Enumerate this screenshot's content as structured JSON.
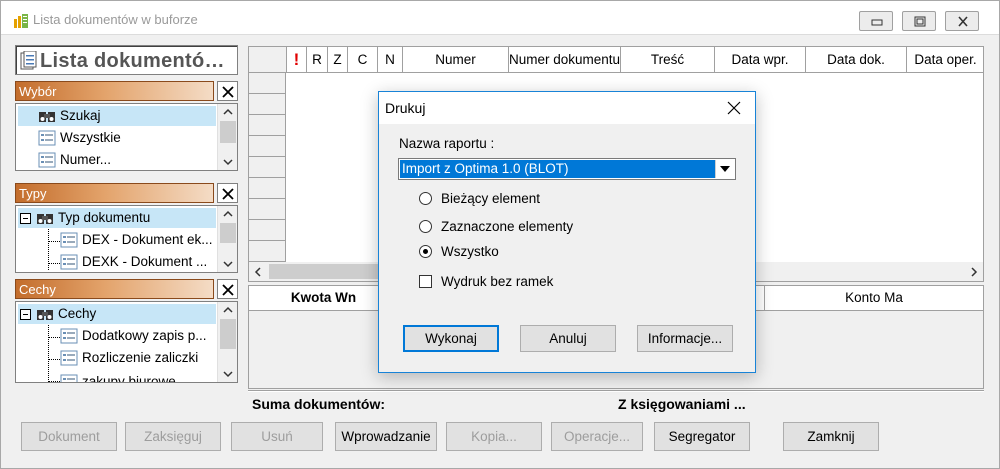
{
  "window": {
    "title": "Lista dokumentów w buforze",
    "controls": [
      "minimize",
      "maximize",
      "close"
    ]
  },
  "left_panel": {
    "title": "Lista dokumentó…",
    "sections": [
      {
        "header": "Wybór",
        "items": [
          {
            "label": "Szukaj",
            "selected": true,
            "icon": "binoculars-icon"
          },
          {
            "label": "Wszystkie",
            "selected": false,
            "icon": "list-icon"
          },
          {
            "label": "Numer...",
            "selected": false,
            "icon": "list-icon"
          }
        ]
      },
      {
        "header": "Typy",
        "items": [
          {
            "label": "Typ dokumentu",
            "selected": true,
            "icon": "binoculars-icon"
          },
          {
            "label": "DEX - Dokument ek...",
            "selected": false,
            "icon": "list-icon"
          },
          {
            "label": "DEXK - Dokument ...",
            "selected": false,
            "icon": "list-icon"
          }
        ]
      },
      {
        "header": "Cechy",
        "items": [
          {
            "label": "Cechy",
            "selected": true,
            "icon": "binoculars-icon"
          },
          {
            "label": "Dodatkowy zapis p...",
            "selected": false,
            "icon": "list-icon"
          },
          {
            "label": "Rozliczenie zaliczki",
            "selected": false,
            "icon": "list-icon"
          },
          {
            "label": "zakupy biurowe",
            "selected": false,
            "icon": "list-icon"
          }
        ]
      }
    ]
  },
  "grid": {
    "columns": [
      "",
      "!",
      "R",
      "Z",
      "C",
      "N",
      "Numer",
      "Numer dokumentu",
      "Treść",
      "Data wpr.",
      "Data dok.",
      "Data oper."
    ]
  },
  "lower_grid": {
    "columns": [
      "Kwota Wn",
      "Konto Ma"
    ]
  },
  "summary": {
    "documents_label": "Suma dokumentów:",
    "posted_label": "Z księgowaniami ..."
  },
  "toolbar": {
    "buttons": [
      {
        "label": "Dokument",
        "enabled": false
      },
      {
        "label": "Zaksięguj",
        "enabled": false
      },
      {
        "label": "Usuń",
        "enabled": false
      },
      {
        "label": "Wprowadzanie",
        "enabled": true
      },
      {
        "label": "Kopia...",
        "enabled": false
      },
      {
        "label": "Operacje...",
        "enabled": false
      },
      {
        "label": "Segregator",
        "enabled": true
      },
      {
        "label": "Zamknij",
        "enabled": true
      }
    ]
  },
  "dialog": {
    "title": "Drukuj",
    "report_label": "Nazwa raportu :",
    "report_value": "Import z Optima 1.0 (BLOT)",
    "options": [
      {
        "label": "Bieżący element",
        "checked": false
      },
      {
        "label": "Zaznaczone elementy",
        "checked": false
      },
      {
        "label": "Wszystko",
        "checked": true
      }
    ],
    "checkbox": {
      "label": "Wydruk bez ramek",
      "checked": false
    },
    "buttons": {
      "execute": "Wykonaj",
      "cancel": "Anuluj",
      "info": "Informacje..."
    }
  },
  "colors": {
    "section_header": "#c36d2c",
    "selection": "#c7e6f7",
    "accent": "#0078d7",
    "alert": "#e00000"
  }
}
